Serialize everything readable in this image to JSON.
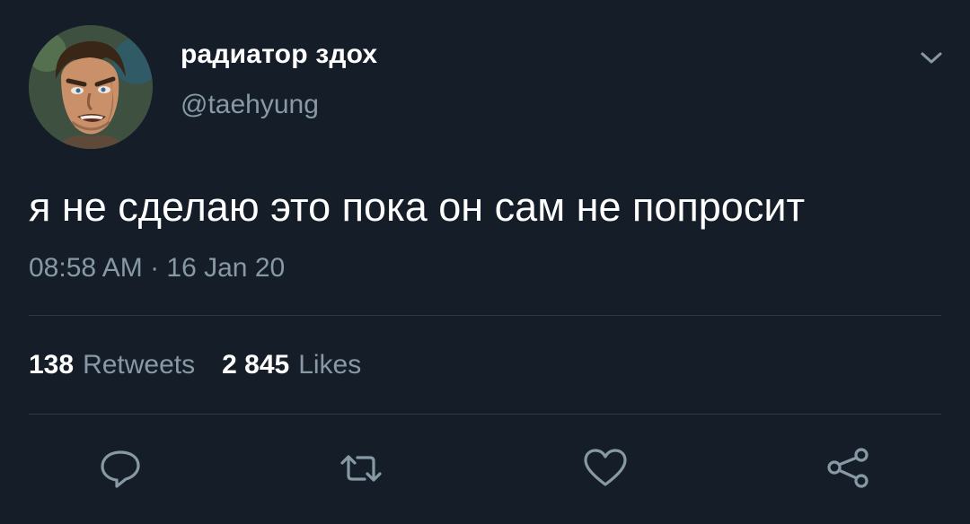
{
  "tweet": {
    "display_name": "радиатор здох",
    "handle": "@taehyung",
    "text": "я не сделаю это пока он сам не попросит",
    "timestamp": "08:58 AM · 16 Jan 20"
  },
  "stats": {
    "retweets_count": "138",
    "retweets_label": "Retweets",
    "likes_count": "2 845",
    "likes_label": "Likes"
  },
  "icons": {
    "caret": "chevron-down-icon",
    "reply": "reply-icon",
    "retweet": "retweet-icon",
    "like": "heart-icon",
    "share": "share-icon"
  },
  "colors": {
    "background": "#151d28",
    "primary_text": "#ffffff",
    "secondary_text": "#8899a6",
    "divider": "#2d3a47"
  }
}
